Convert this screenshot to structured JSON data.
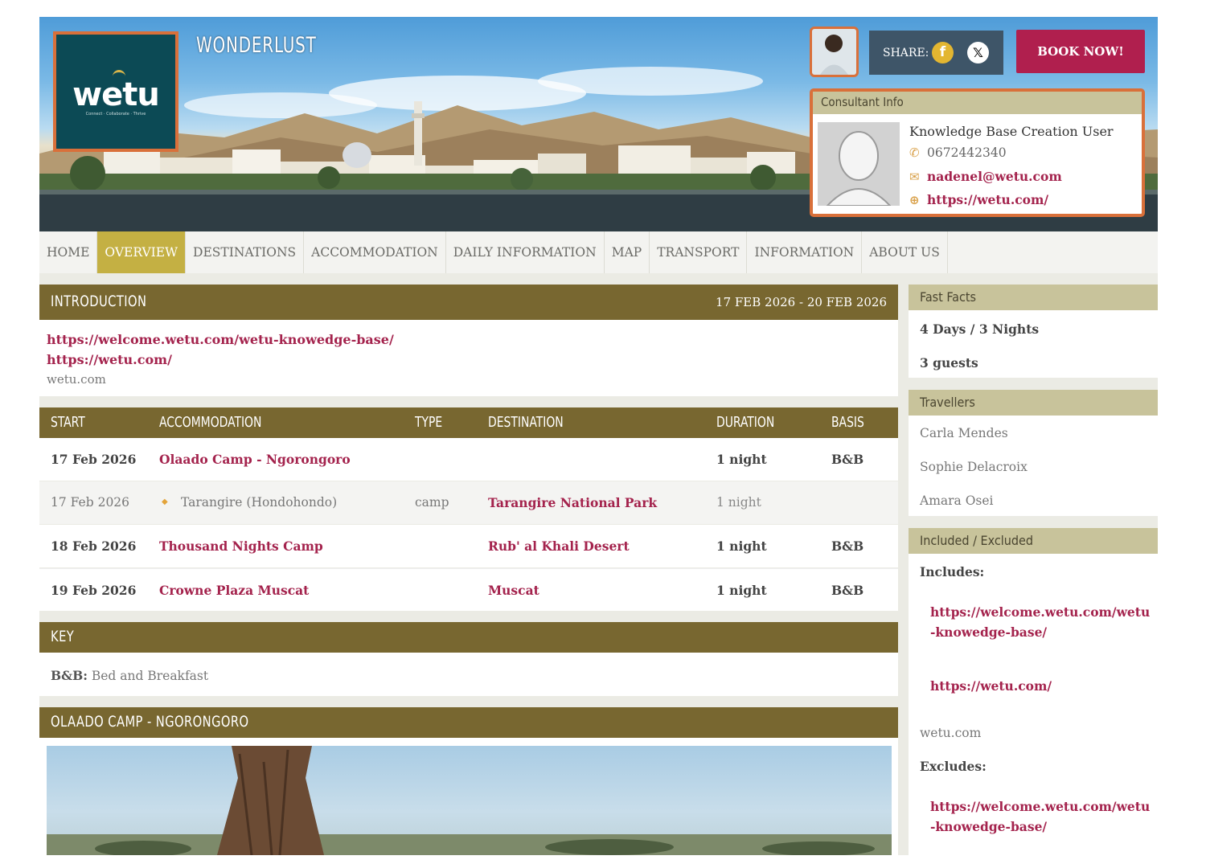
{
  "header": {
    "brand_title": "WONDERLUST",
    "logo_text": "wetu",
    "logo_tagline": "Connect · Collaborate · Thrive",
    "share_label": "SHARE:",
    "facebook_icon": "f",
    "x_icon": "𝕏",
    "book_label": "BOOK NOW!"
  },
  "consultant": {
    "heading": "Consultant Info",
    "name": "Knowledge Base Creation User",
    "phone": "0672442340",
    "email": "nadenel@wetu.com",
    "website": "https://wetu.com/",
    "phone_icon": "✆",
    "email_icon": "✉",
    "web_icon": "⊕"
  },
  "nav": {
    "items": [
      "HOME",
      "OVERVIEW",
      "DESTINATIONS",
      "ACCOMMODATION",
      "DAILY INFORMATION",
      "MAP",
      "TRANSPORT",
      "INFORMATION",
      "ABOUT US"
    ],
    "active": "OVERVIEW"
  },
  "intro": {
    "title": "INTRODUCTION",
    "date_range": "17 FEB 2026 - 20 FEB 2026",
    "link1": "https://welcome.wetu.com/wetu-knowedge-base/",
    "link2": "https://wetu.com/",
    "text": "wetu.com"
  },
  "itinerary": {
    "headers": [
      "START",
      "ACCOMMODATION",
      "TYPE",
      "DESTINATION",
      "DURATION",
      "BASIS"
    ],
    "rows": [
      {
        "start": "17 Feb 2026",
        "accommodation": "Olaado Camp - Ngorongoro",
        "type": "",
        "destination": "",
        "duration": "1 night",
        "basis": "B&B"
      },
      {
        "start": "17 Feb 2026",
        "accommodation": "Tarangire (Hondohondo)",
        "type": "camp",
        "destination": "Tarangire National Park",
        "duration": "1 night",
        "basis": ""
      },
      {
        "start": "18 Feb 2026",
        "accommodation": "Thousand Nights Camp",
        "type": "",
        "destination": "Rub' al Khali Desert",
        "duration": "1 night",
        "basis": "B&B"
      },
      {
        "start": "19 Feb 2026",
        "accommodation": "Crowne Plaza Muscat",
        "type": "",
        "destination": "Muscat",
        "duration": "1 night",
        "basis": "B&B"
      }
    ]
  },
  "key": {
    "title": "KEY",
    "abbr": "B&B:",
    "meaning": "Bed and Breakfast"
  },
  "camp_section": {
    "title": "OLAADO CAMP - NGORONGORO"
  },
  "sidebar": {
    "fast_facts": {
      "heading": "Fast Facts",
      "duration": "4 Days / 3 Nights",
      "guests": "3 guests"
    },
    "travellers": {
      "heading": "Travellers",
      "names": [
        "Carla Mendes",
        "Sophie Delacroix",
        "Amara Osei"
      ]
    },
    "included": {
      "heading": "Included / Excluded",
      "includes_label": "Includes:",
      "inc_link1_a": "https://welcome.wetu.com/wetu",
      "inc_link1_b": "-knowedge-base/",
      "inc_link2": "https://wetu.com/",
      "inc_text": "wetu.com",
      "excludes_label": "Excludes:",
      "exc_link1_a": "https://welcome.wetu.com/wetu",
      "exc_link1_b": "-knowedge-base/"
    }
  },
  "colors": {
    "accent_bar": "#786730",
    "nav_active": "#c4b043",
    "link": "#a4234d",
    "book_button": "#b01f4e",
    "highlight_border": "#d9703a"
  }
}
